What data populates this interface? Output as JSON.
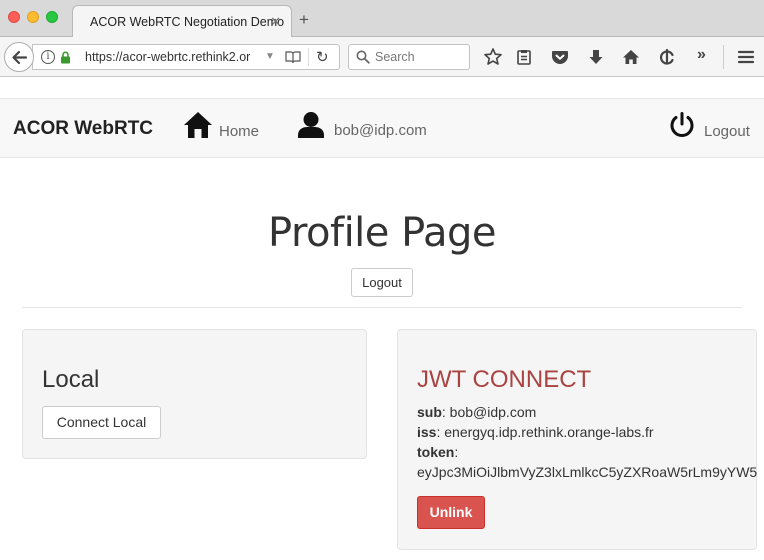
{
  "browser": {
    "tab_title": "ACOR WebRTC Negotiation Demo",
    "tab_close": "✕",
    "new_tab": "+",
    "url": "https://acor-webrtc.rethink2.or",
    "search_placeholder": "Search"
  },
  "appnav": {
    "brand": "ACOR WebRTC",
    "home_label": "Home",
    "user_label": "bob@idp.com",
    "logout_label": "Logout"
  },
  "main": {
    "title": "Profile Page",
    "logout_button": "Logout"
  },
  "local": {
    "title": "Local",
    "connect_button": "Connect Local"
  },
  "jwt": {
    "title": "JWT CONNECT",
    "sub_key": "sub",
    "sub_value": ": bob@idp.com",
    "iss_key": "iss",
    "iss_value": ": energyq.idp.rethink.orange-labs.fr",
    "token_key": "token",
    "token_value": "eyJpc3MiOiJlbmVyZ3lxLmlkcC5yZXRoaW5rLm9yYW5",
    "unlink_button": "Unlink"
  },
  "icons": [
    "back-arrow-icon",
    "info-icon",
    "lock-icon",
    "reader-view-icon",
    "reload-icon",
    "search-icon",
    "bookmark-star-icon",
    "reading-list-icon",
    "pocket-icon",
    "download-icon",
    "home-icon",
    "sync-icon",
    "overflow-icon",
    "hamburger-menu-icon",
    "user-icon",
    "power-icon"
  ],
  "colors": {
    "danger": "#d9534f",
    "jwt_title": "#a94442",
    "navbar_bg": "#f8f8f8",
    "well_bg": "#f5f5f5"
  }
}
